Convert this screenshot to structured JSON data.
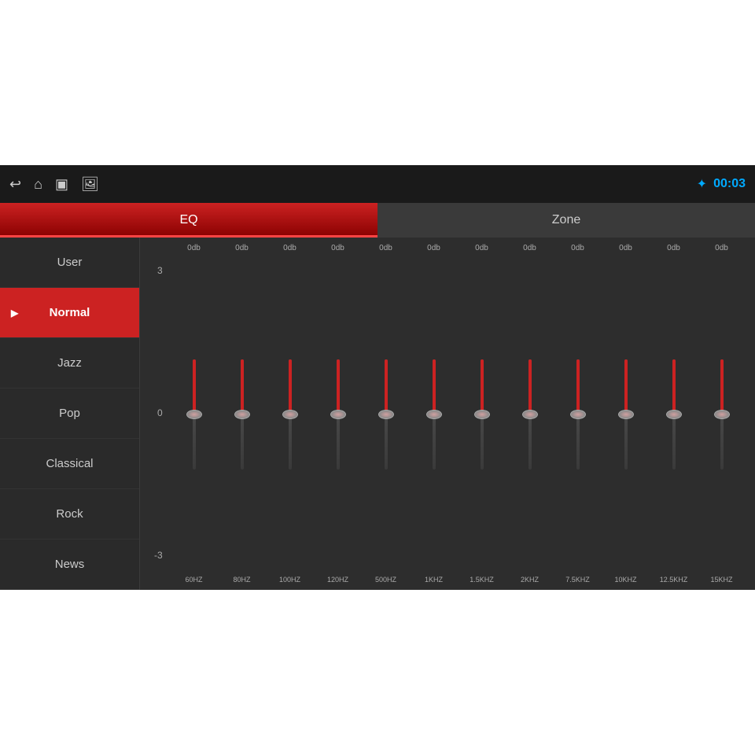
{
  "topbar": {
    "clock": "00:03",
    "bluetooth_icon": "✦",
    "back_icon": "↩",
    "home_icon": "⌂",
    "window_icon": "▣",
    "image_icon": "🖼"
  },
  "tabs": {
    "eq_label": "EQ",
    "zone_label": "Zone"
  },
  "sidebar": {
    "items": [
      {
        "label": "User",
        "active": false
      },
      {
        "label": "Normal",
        "active": true
      },
      {
        "label": "Jazz",
        "active": false
      },
      {
        "label": "Pop",
        "active": false
      },
      {
        "label": "Classical",
        "active": false
      },
      {
        "label": "Rock",
        "active": false
      },
      {
        "label": "News",
        "active": false
      }
    ]
  },
  "eq": {
    "y_labels": [
      "3",
      "0",
      "-3"
    ],
    "sliders": [
      {
        "freq": "60HZ",
        "db": "0db",
        "value": 0
      },
      {
        "freq": "80HZ",
        "db": "0db",
        "value": 0
      },
      {
        "freq": "100HZ",
        "db": "0db",
        "value": 0
      },
      {
        "freq": "120HZ",
        "db": "0db",
        "value": 0
      },
      {
        "freq": "500HZ",
        "db": "0db",
        "value": 0
      },
      {
        "freq": "1KHZ",
        "db": "0db",
        "value": 0
      },
      {
        "freq": "1.5KHZ",
        "db": "0db",
        "value": 0
      },
      {
        "freq": "2KHZ",
        "db": "0db",
        "value": 0
      },
      {
        "freq": "7.5KHZ",
        "db": "0db",
        "value": 0
      },
      {
        "freq": "10KHZ",
        "db": "0db",
        "value": 0
      },
      {
        "freq": "12.5KHZ",
        "db": "0db",
        "value": 0
      },
      {
        "freq": "15KHZ",
        "db": "0db",
        "value": 0
      }
    ]
  }
}
